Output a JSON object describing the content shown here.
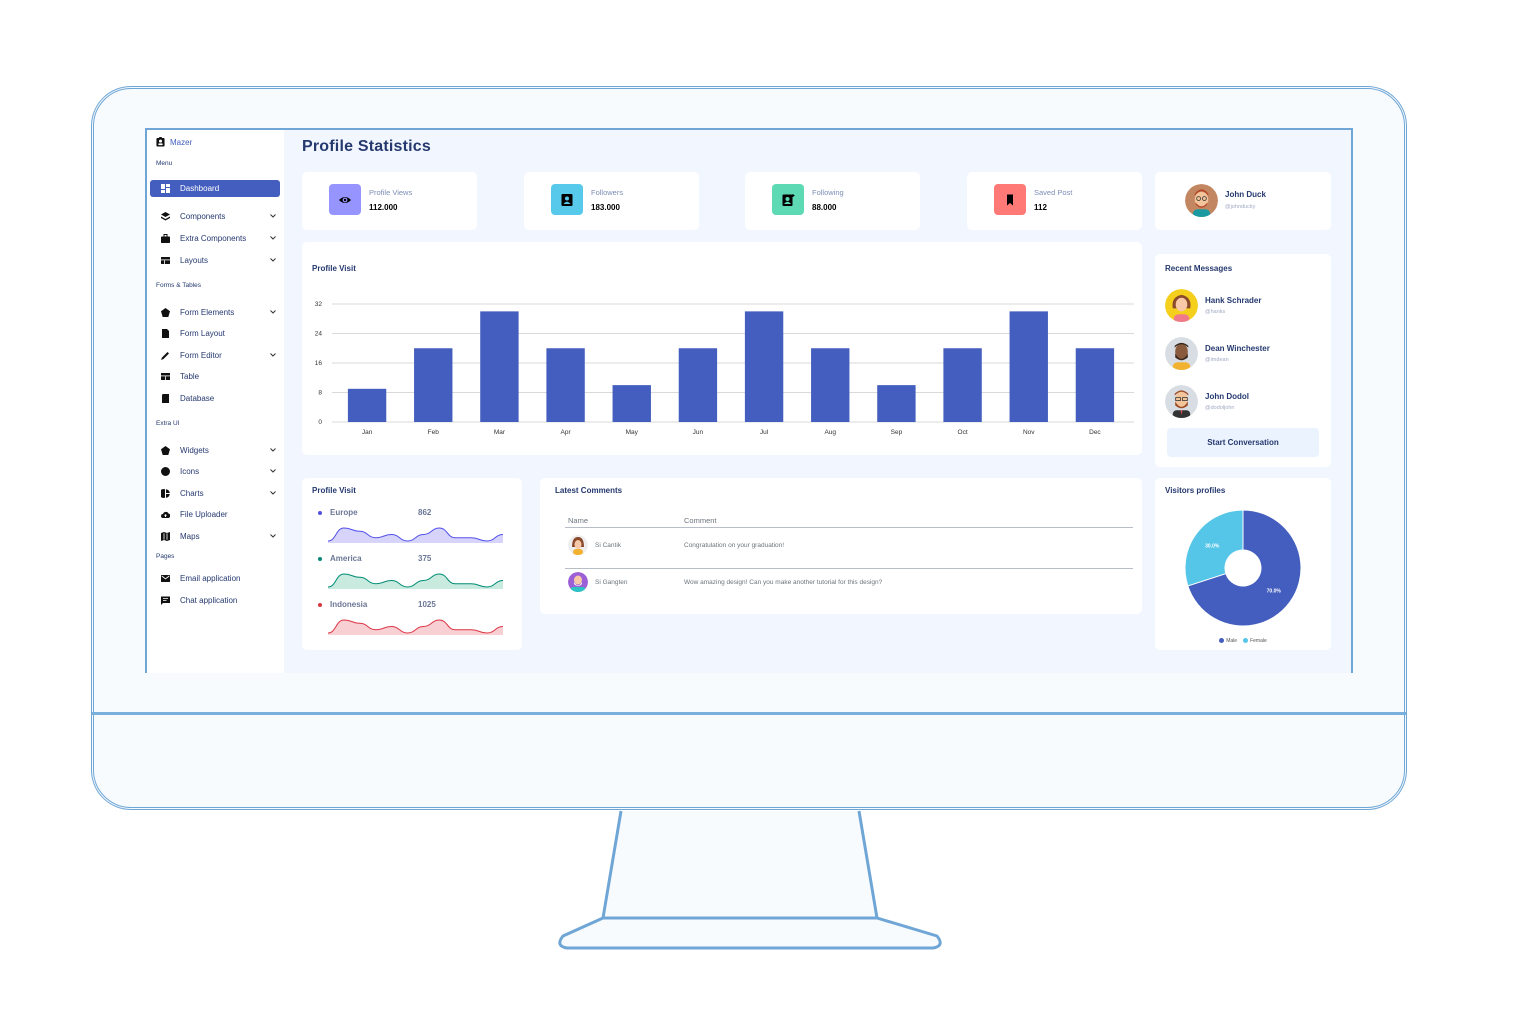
{
  "app": {
    "brand": "Mazer",
    "page_title": "Profile Statistics"
  },
  "sidebar": {
    "sections": [
      {
        "title": "Menu",
        "items": [
          {
            "label": "Dashboard",
            "icon": "grid-icon",
            "active": true,
            "has_submenu": false
          },
          {
            "label": "Components",
            "icon": "stack-icon",
            "active": false,
            "has_submenu": true
          },
          {
            "label": "Extra Components",
            "icon": "briefcase-icon",
            "active": false,
            "has_submenu": true
          },
          {
            "label": "Layouts",
            "icon": "layout-icon",
            "active": false,
            "has_submenu": true
          }
        ]
      },
      {
        "title": "Forms & Tables",
        "items": [
          {
            "label": "Form Elements",
            "icon": "pentagon-icon",
            "active": false,
            "has_submenu": true
          },
          {
            "label": "Form Layout",
            "icon": "file-icon",
            "active": false,
            "has_submenu": false
          },
          {
            "label": "Form Editor",
            "icon": "pen-icon",
            "active": false,
            "has_submenu": true
          },
          {
            "label": "Table",
            "icon": "table-icon",
            "active": false,
            "has_submenu": false
          },
          {
            "label": "Database",
            "icon": "database-icon",
            "active": false,
            "has_submenu": false
          }
        ]
      },
      {
        "title": "Extra UI",
        "items": [
          {
            "label": "Widgets",
            "icon": "pentagon-icon",
            "active": false,
            "has_submenu": true
          },
          {
            "label": "Icons",
            "icon": "circle-icon",
            "active": false,
            "has_submenu": true
          },
          {
            "label": "Charts",
            "icon": "pie-chart-icon",
            "active": false,
            "has_submenu": true
          },
          {
            "label": "File Uploader",
            "icon": "cloud-upload-icon",
            "active": false,
            "has_submenu": false
          },
          {
            "label": "Maps",
            "icon": "map-icon",
            "active": false,
            "has_submenu": true
          }
        ]
      },
      {
        "title": "Pages",
        "items": [
          {
            "label": "Email application",
            "icon": "envelope-icon",
            "active": false,
            "has_submenu": false
          },
          {
            "label": "Chat application",
            "icon": "chat-icon",
            "active": false,
            "has_submenu": false
          }
        ]
      }
    ]
  },
  "stats": [
    {
      "label": "Profile Views",
      "value": "112.000",
      "icon": "eye-icon",
      "color": "#9694ff"
    },
    {
      "label": "Followers",
      "value": "183.000",
      "icon": "user-icon",
      "color": "#57caeb"
    },
    {
      "label": "Following",
      "value": "88.000",
      "icon": "user-plus-icon",
      "color": "#5ddab4"
    },
    {
      "label": "Saved Post",
      "value": "112",
      "icon": "bookmark-icon",
      "color": "#ff7976"
    }
  ],
  "profile": {
    "name": "John Duck",
    "handle": "@johnducky"
  },
  "colors": {
    "accent": "#435ebe",
    "bar": "#435ebe",
    "background": "#f2f7ff",
    "frame": "#6fa6d6"
  },
  "chart_data": [
    {
      "type": "bar",
      "title": "Profile Visit",
      "categories": [
        "Jan",
        "Feb",
        "Mar",
        "Apr",
        "May",
        "Jun",
        "Jul",
        "Aug",
        "Sep",
        "Oct",
        "Nov",
        "Dec"
      ],
      "values": [
        9,
        20,
        30,
        20,
        10,
        20,
        30,
        20,
        10,
        20,
        30,
        20
      ],
      "yticks": [
        "0",
        "8",
        "16",
        "24",
        "32"
      ],
      "ylim": [
        0,
        32
      ],
      "xlabel": "",
      "ylabel": "",
      "grid": true
    },
    {
      "type": "pie",
      "title": "Visitors profiles",
      "labels": [
        "Male",
        "Female"
      ],
      "values": [
        70.0,
        30.0
      ],
      "slice_labels": [
        "70.0%",
        "30.0%"
      ],
      "colors": [
        "#435ebe",
        "#55c6e8"
      ],
      "legend": "bottom"
    }
  ],
  "profile_visit_regions": {
    "title": "Profile Visit",
    "regions": [
      {
        "name": "Europe",
        "value": "862",
        "color": "#5350e9",
        "fill": "#d6d4fb",
        "series": [
          2,
          6,
          5,
          3,
          4,
          2,
          4,
          6,
          3,
          3,
          2,
          4
        ]
      },
      {
        "name": "America",
        "value": "375",
        "color": "#008b75",
        "fill": "#c8eadf",
        "series": [
          2,
          6,
          5,
          3,
          4,
          2,
          4,
          6,
          3,
          3,
          2,
          4
        ]
      },
      {
        "name": "Indonesia",
        "value": "1025",
        "color": "#dc3545",
        "fill": "#f8cfd3",
        "series": [
          2,
          6,
          5,
          3,
          4,
          2,
          4,
          6,
          3,
          3,
          2,
          4
        ]
      }
    ]
  },
  "recent_messages": {
    "title": "Recent Messages",
    "people": [
      {
        "name": "Hank Schrader",
        "handle": "@hanks"
      },
      {
        "name": "Dean Winchester",
        "handle": "@imdean"
      },
      {
        "name": "John Dodol",
        "handle": "@dodoljohn"
      }
    ],
    "button_label": "Start Conversation"
  },
  "latest_comments": {
    "title": "Latest Comments",
    "columns": [
      "Name",
      "Comment"
    ],
    "rows": [
      {
        "name": "Si Cantik",
        "comment": "Congratulation on your graduation!"
      },
      {
        "name": "Si Gangten",
        "comment": "Wow amazing design! Can you make another tutorial for this design?"
      }
    ]
  }
}
